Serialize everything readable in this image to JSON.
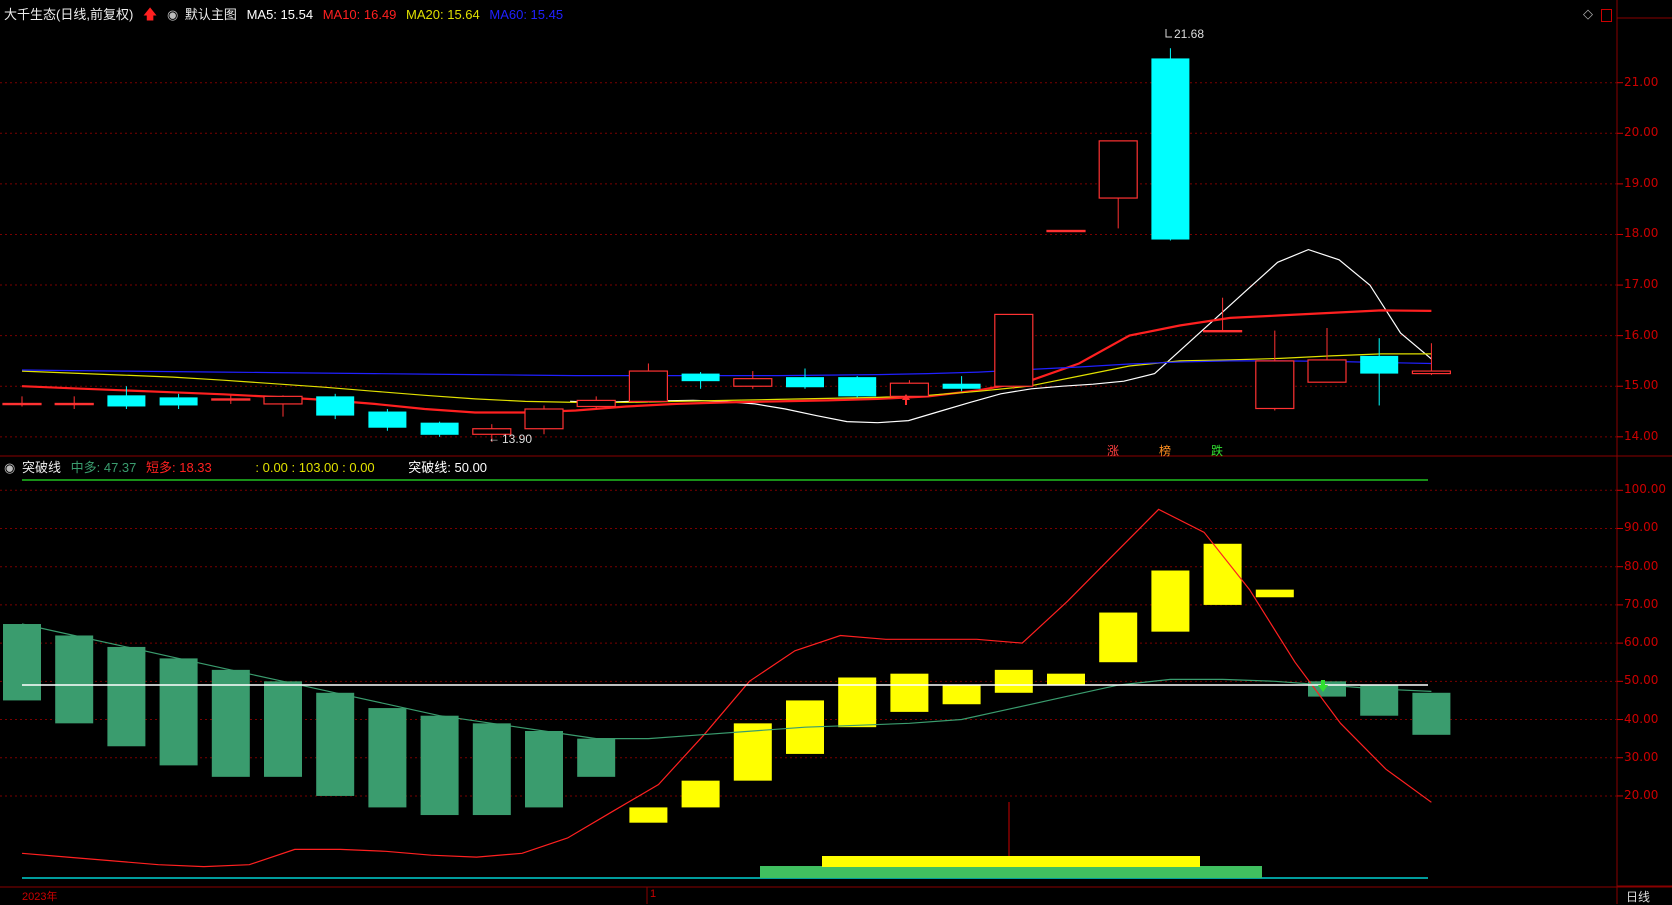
{
  "main_header": {
    "stock_name": "大千生态",
    "mode": "(日线,前复权)",
    "chart_name": "默认主图",
    "ma5_label": "MA5: 15.54",
    "ma10_label": "MA10: 16.49",
    "ma20_label": "MA20: 15.64",
    "ma60_label": "MA60: 15.45"
  },
  "sub_header": {
    "indicator_name": "突破线",
    "mid_label": "中多: 47.37",
    "short_label": "短多: 18.33",
    "values_label": ": 0.00 : 103.00 : 0.00",
    "line_label": "突破线: 50.00"
  },
  "annotations": {
    "high_label": "21.68",
    "low_label": "13.90",
    "tag_up": "涨",
    "tag_list": "榜",
    "tag_down": "跌"
  },
  "bottom": {
    "year_label": "2023年",
    "month_label": "1",
    "period_button": "日线"
  },
  "colors": {
    "up": "#ff3232",
    "down": "#00ffff",
    "ma5": "#ffffff",
    "ma10": "#ff2020",
    "ma20": "#e0e000",
    "ma60": "#2020ff",
    "grid": "#7a0000",
    "bar_green": "#3a9c6e",
    "bar_yellow": "#ffff00"
  },
  "chart_data": [
    {
      "type": "candlestick",
      "y_ticks": [
        "21.00",
        "20.00",
        "19.00",
        "18.00",
        "17.00",
        "16.00",
        "15.00",
        "14.00"
      ],
      "ylim": [
        13.7,
        22.2
      ],
      "candles": [
        {
          "o": 14.66,
          "c": 14.66,
          "h": 14.8,
          "l": 14.6
        },
        {
          "o": 14.66,
          "c": 14.66,
          "h": 14.8,
          "l": 14.55
        },
        {
          "o": 14.82,
          "c": 14.6,
          "h": 15.0,
          "l": 14.55
        },
        {
          "o": 14.78,
          "c": 14.62,
          "h": 14.85,
          "l": 14.55
        },
        {
          "o": 14.75,
          "c": 14.75,
          "h": 14.82,
          "l": 14.65
        },
        {
          "o": 14.65,
          "c": 14.8,
          "h": 14.82,
          "l": 14.4
        },
        {
          "o": 14.8,
          "c": 14.42,
          "h": 14.85,
          "l": 14.35
        },
        {
          "o": 14.5,
          "c": 14.18,
          "h": 14.55,
          "l": 14.12
        },
        {
          "o": 14.28,
          "c": 14.04,
          "h": 14.3,
          "l": 14.0
        },
        {
          "o": 14.05,
          "c": 14.16,
          "h": 14.25,
          "l": 13.9
        },
        {
          "o": 14.16,
          "c": 14.55,
          "h": 14.62,
          "l": 14.05
        },
        {
          "o": 14.6,
          "c": 14.72,
          "h": 14.8,
          "l": 14.55
        },
        {
          "o": 14.7,
          "c": 15.3,
          "h": 15.45,
          "l": 14.68
        },
        {
          "o": 15.25,
          "c": 15.1,
          "h": 15.28,
          "l": 14.95
        },
        {
          "o": 15.0,
          "c": 15.15,
          "h": 15.3,
          "l": 14.95
        },
        {
          "o": 15.18,
          "c": 14.98,
          "h": 15.35,
          "l": 14.95
        },
        {
          "o": 15.18,
          "c": 14.8,
          "h": 15.2,
          "l": 14.78
        },
        {
          "o": 14.8,
          "c": 15.06,
          "h": 15.12,
          "l": 14.78
        },
        {
          "o": 15.05,
          "c": 14.95,
          "h": 15.2,
          "l": 14.9
        },
        {
          "o": 15.0,
          "c": 16.42,
          "h": 16.42,
          "l": 14.95
        },
        {
          "o": 18.08,
          "c": 18.08,
          "h": 18.08,
          "l": 18.08
        },
        {
          "o": 18.72,
          "c": 19.85,
          "h": 19.85,
          "l": 18.12
        },
        {
          "o": 21.48,
          "c": 17.9,
          "h": 21.68,
          "l": 17.88
        },
        {
          "o": 16.1,
          "c": 16.1,
          "h": 16.75,
          "l": 16.1
        },
        {
          "o": 14.56,
          "c": 15.5,
          "h": 16.1,
          "l": 14.52
        },
        {
          "o": 15.08,
          "c": 15.52,
          "h": 16.15,
          "l": 15.08
        },
        {
          "o": 15.6,
          "c": 15.25,
          "h": 15.95,
          "l": 14.62
        },
        {
          "o": 15.25,
          "c": 15.3,
          "h": 15.85,
          "l": 15.22
        }
      ],
      "series": [
        {
          "name": "MA5",
          "values": [
            14.7,
            14.68,
            14.7,
            14.71,
            14.72,
            14.7,
            14.65,
            14.55,
            14.42,
            14.3,
            14.28,
            14.32,
            14.5,
            14.68,
            14.85,
            14.95,
            15.0,
            15.04,
            15.1,
            15.25,
            15.8,
            16.35,
            16.9,
            17.45,
            17.7,
            17.5,
            17.0,
            16.05,
            15.54
          ]
        },
        {
          "name": "MA10",
          "values": [
            15.0,
            14.96,
            14.92,
            14.88,
            14.84,
            14.79,
            14.73,
            14.65,
            14.55,
            14.48,
            14.48,
            14.52,
            14.6,
            14.65,
            14.68,
            14.7,
            14.72,
            14.75,
            14.8,
            14.92,
            15.1,
            15.45,
            16.0,
            16.2,
            16.35,
            16.4,
            16.45,
            16.5,
            16.49
          ]
        },
        {
          "name": "MA20",
          "values": [
            15.3,
            15.26,
            15.22,
            15.18,
            15.12,
            15.05,
            14.98,
            14.9,
            14.82,
            14.75,
            14.7,
            14.68,
            14.68,
            14.7,
            14.72,
            14.74,
            14.76,
            14.78,
            14.82,
            14.9,
            15.0,
            15.2,
            15.4,
            15.5,
            15.52,
            15.55,
            15.6,
            15.64,
            15.64
          ]
        },
        {
          "name": "MA60",
          "values": [
            15.32,
            15.31,
            15.3,
            15.29,
            15.28,
            15.27,
            15.26,
            15.25,
            15.24,
            15.23,
            15.22,
            15.21,
            15.21,
            15.21,
            15.21,
            15.21,
            15.22,
            15.23,
            15.25,
            15.28,
            15.33,
            15.38,
            15.44,
            15.48,
            15.5,
            15.5,
            15.49,
            15.47,
            15.45
          ]
        }
      ]
    },
    {
      "type": "bar",
      "y_ticks": [
        "100.00",
        "90.00",
        "80.00",
        "70.00",
        "60.00",
        "50.00",
        "40.00",
        "30.00",
        "20.00"
      ],
      "ylim": [
        -2,
        104
      ],
      "bars": [
        {
          "lo": 45,
          "hi": 65,
          "color": "green"
        },
        {
          "lo": 39,
          "hi": 62,
          "color": "green"
        },
        {
          "lo": 33,
          "hi": 59,
          "color": "green"
        },
        {
          "lo": 28,
          "hi": 56,
          "color": "green"
        },
        {
          "lo": 25,
          "hi": 53,
          "color": "green"
        },
        {
          "lo": 25,
          "hi": 50,
          "color": "green"
        },
        {
          "lo": 20,
          "hi": 47,
          "color": "green"
        },
        {
          "lo": 17,
          "hi": 43,
          "color": "green"
        },
        {
          "lo": 15,
          "hi": 41,
          "color": "green"
        },
        {
          "lo": 15,
          "hi": 39,
          "color": "green"
        },
        {
          "lo": 17,
          "hi": 37,
          "color": "green"
        },
        {
          "lo": 25,
          "hi": 35,
          "color": "green"
        },
        {
          "lo": 13,
          "hi": 17,
          "color": "yellow"
        },
        {
          "lo": 17,
          "hi": 24,
          "color": "yellow"
        },
        {
          "lo": 24,
          "hi": 39,
          "color": "yellow"
        },
        {
          "lo": 31,
          "hi": 45,
          "color": "yellow"
        },
        {
          "lo": 38,
          "hi": 51,
          "color": "yellow"
        },
        {
          "lo": 42,
          "hi": 52,
          "color": "yellow"
        },
        {
          "lo": 44,
          "hi": 49,
          "color": "yellow"
        },
        {
          "lo": 47,
          "hi": 53,
          "color": "yellow"
        },
        {
          "lo": 49,
          "hi": 52,
          "color": "yellow"
        },
        {
          "lo": 55,
          "hi": 68,
          "color": "yellow"
        },
        {
          "lo": 63,
          "hi": 79,
          "color": "yellow"
        },
        {
          "lo": 70,
          "hi": 86,
          "color": "yellow"
        },
        {
          "lo": 72,
          "hi": 74,
          "color": "yellow"
        },
        {
          "lo": 46,
          "hi": 50,
          "color": "green"
        },
        {
          "lo": 41,
          "hi": 49,
          "color": "green"
        },
        {
          "lo": 36,
          "hi": 47,
          "color": "green"
        }
      ],
      "series": [
        {
          "name": "短多",
          "values": [
            5,
            4,
            3,
            2,
            1.5,
            2,
            6,
            6,
            5.5,
            4.5,
            4,
            5,
            9,
            16,
            23,
            36,
            50,
            58,
            62,
            61,
            61,
            61,
            60,
            71,
            83,
            95,
            89,
            74,
            55,
            39,
            27,
            18.33
          ]
        },
        {
          "name": "中多",
          "values": [
            65,
            62,
            59,
            56,
            53,
            50,
            47,
            44,
            41,
            39,
            37,
            35,
            35,
            36,
            37,
            38,
            38.5,
            39,
            40,
            43,
            46,
            49,
            50.5,
            50.5,
            50,
            49,
            48,
            47.37
          ]
        },
        {
          "name": "突破线",
          "values": [
            50
          ]
        }
      ]
    }
  ]
}
